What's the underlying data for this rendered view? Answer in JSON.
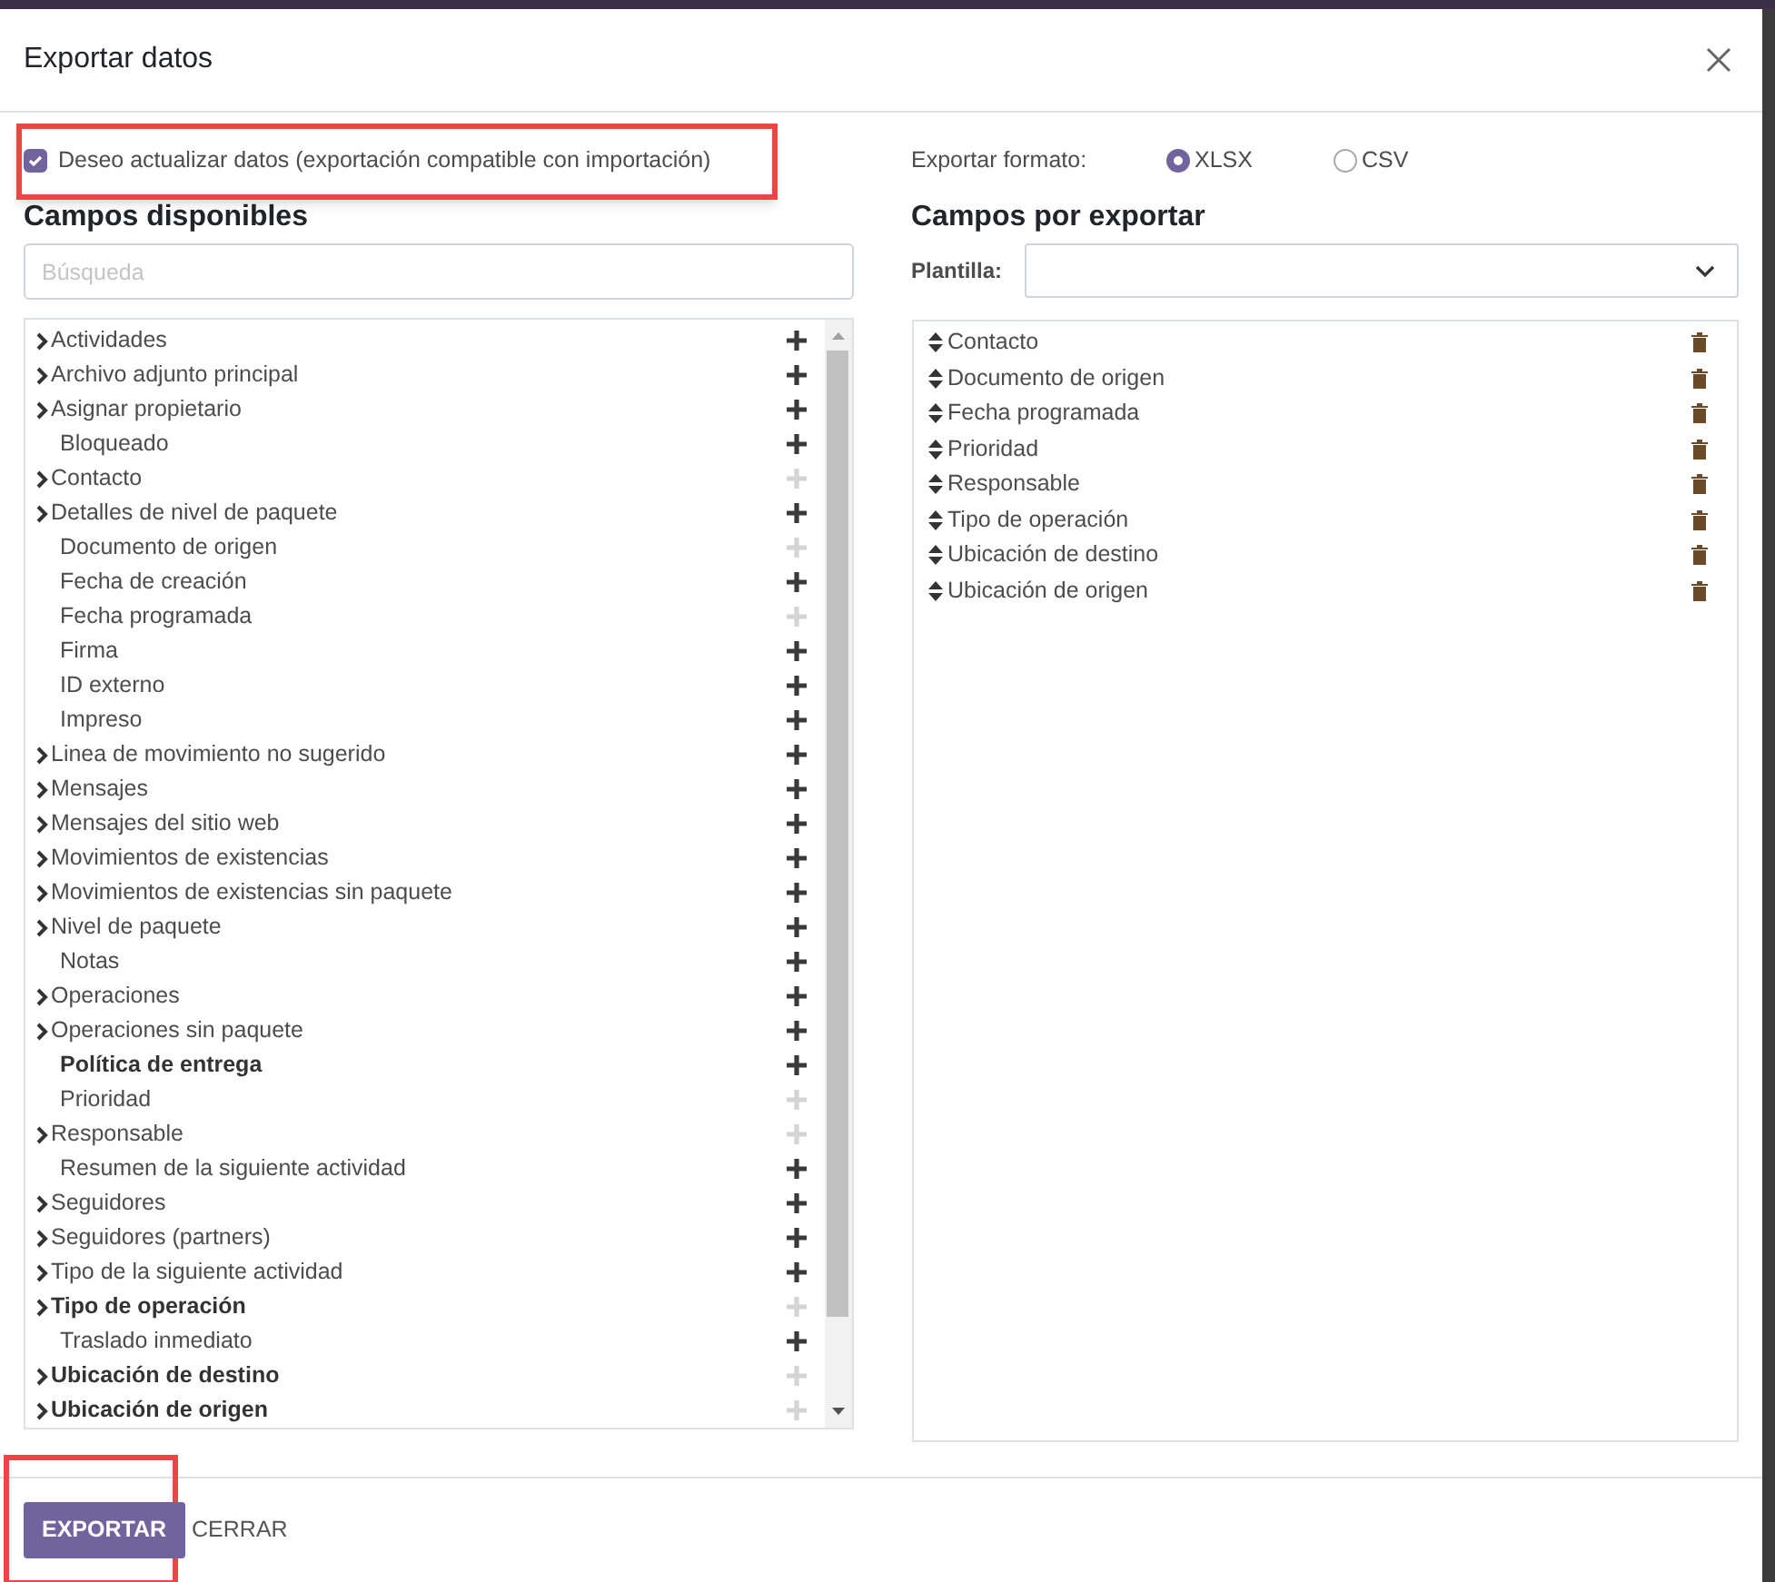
{
  "dialog": {
    "title": "Exportar datos"
  },
  "import_compatible": {
    "label": "Deseo actualizar datos (exportación compatible con importación)",
    "checked": true
  },
  "available": {
    "title": "Campos disponibles",
    "search": {
      "placeholder": "Búsqueda"
    },
    "fields": [
      {
        "label": "Actividades",
        "expandable": true,
        "bold": false,
        "added": false
      },
      {
        "label": "Archivo adjunto principal",
        "expandable": true,
        "bold": false,
        "added": false
      },
      {
        "label": "Asignar propietario",
        "expandable": true,
        "bold": false,
        "added": false
      },
      {
        "label": "Bloqueado",
        "expandable": false,
        "bold": false,
        "added": false
      },
      {
        "label": "Contacto",
        "expandable": true,
        "bold": false,
        "added": true
      },
      {
        "label": "Detalles de nivel de paquete",
        "expandable": true,
        "bold": false,
        "added": false
      },
      {
        "label": "Documento de origen",
        "expandable": false,
        "bold": false,
        "added": true
      },
      {
        "label": "Fecha de creación",
        "expandable": false,
        "bold": false,
        "added": false
      },
      {
        "label": "Fecha programada",
        "expandable": false,
        "bold": false,
        "added": true
      },
      {
        "label": "Firma",
        "expandable": false,
        "bold": false,
        "added": false
      },
      {
        "label": "ID externo",
        "expandable": false,
        "bold": false,
        "added": false
      },
      {
        "label": "Impreso",
        "expandable": false,
        "bold": false,
        "added": false
      },
      {
        "label": "Linea de movimiento no sugerido",
        "expandable": true,
        "bold": false,
        "added": false
      },
      {
        "label": "Mensajes",
        "expandable": true,
        "bold": false,
        "added": false
      },
      {
        "label": "Mensajes del sitio web",
        "expandable": true,
        "bold": false,
        "added": false
      },
      {
        "label": "Movimientos de existencias",
        "expandable": true,
        "bold": false,
        "added": false
      },
      {
        "label": "Movimientos de existencias sin paquete",
        "expandable": true,
        "bold": false,
        "added": false
      },
      {
        "label": "Nivel de paquete",
        "expandable": true,
        "bold": false,
        "added": false
      },
      {
        "label": "Notas",
        "expandable": false,
        "bold": false,
        "added": false
      },
      {
        "label": "Operaciones",
        "expandable": true,
        "bold": false,
        "added": false
      },
      {
        "label": "Operaciones sin paquete",
        "expandable": true,
        "bold": false,
        "added": false
      },
      {
        "label": "Política de entrega",
        "expandable": false,
        "bold": true,
        "added": false
      },
      {
        "label": "Prioridad",
        "expandable": false,
        "bold": false,
        "added": true
      },
      {
        "label": "Responsable",
        "expandable": true,
        "bold": false,
        "added": true
      },
      {
        "label": "Resumen de la siguiente actividad",
        "expandable": false,
        "bold": false,
        "added": false
      },
      {
        "label": "Seguidores",
        "expandable": true,
        "bold": false,
        "added": false
      },
      {
        "label": "Seguidores (partners)",
        "expandable": true,
        "bold": false,
        "added": false
      },
      {
        "label": "Tipo de la siguiente actividad",
        "expandable": true,
        "bold": false,
        "added": false
      },
      {
        "label": "Tipo de operación",
        "expandable": true,
        "bold": true,
        "added": true
      },
      {
        "label": "Traslado inmediato",
        "expandable": false,
        "bold": false,
        "added": false
      },
      {
        "label": "Ubicación de destino",
        "expandable": true,
        "bold": true,
        "added": true
      },
      {
        "label": "Ubicación de origen",
        "expandable": true,
        "bold": true,
        "added": true
      }
    ]
  },
  "format": {
    "label": "Exportar formato:",
    "options": [
      {
        "label": "XLSX",
        "selected": true
      },
      {
        "label": "CSV",
        "selected": false
      }
    ]
  },
  "export_fields": {
    "title": "Campos por exportar",
    "template_label": "Plantilla:",
    "fields": [
      "Contacto",
      "Documento de origen",
      "Fecha programada",
      "Prioridad",
      "Responsable",
      "Tipo de operación",
      "Ubicación de destino",
      "Ubicación de origen"
    ]
  },
  "buttons": {
    "export": "EXPORTAR",
    "close": "CERRAR"
  }
}
